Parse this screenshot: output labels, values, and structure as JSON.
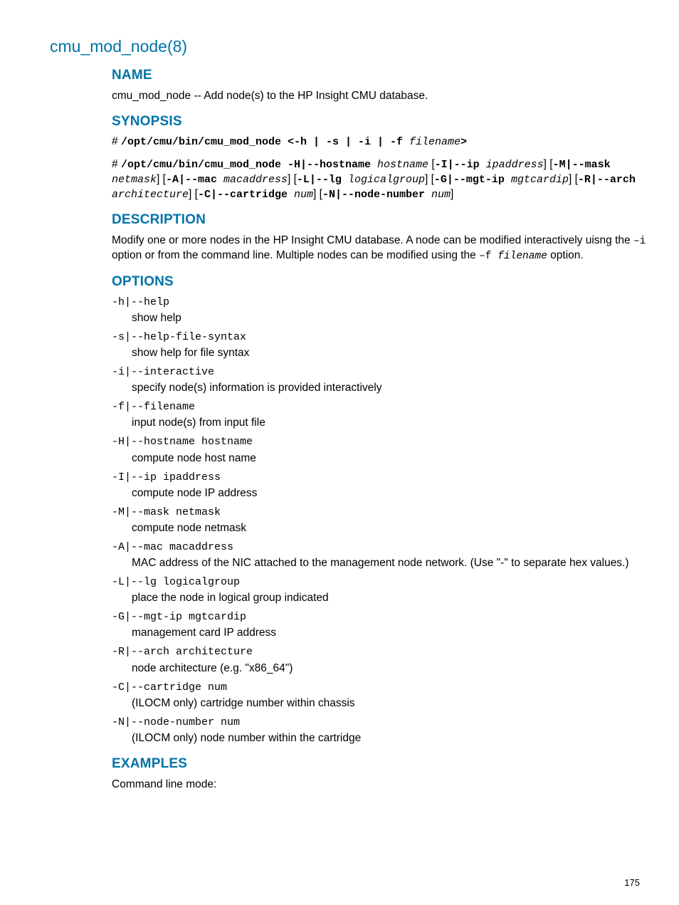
{
  "pageTitle": "cmu_mod_node(8)",
  "sections": {
    "name": {
      "heading": "NAME",
      "text_a": "cmu_mod_node -- Add node(s) to the HP Insight CMU database."
    },
    "synopsis": {
      "heading": "SYNOPSIS",
      "line1": {
        "prefix": "# ",
        "cmd": "/opt/cmu/bin/cmu_mod_node",
        "opts": " <-h | -s | -i | -f ",
        "arg": "filename",
        "end": ">"
      },
      "line2": {
        "prefix": "# ",
        "cmd": "/opt/cmu/bin/cmu_mod_node -H|--hostname ",
        "arg_host": "hostname",
        "seg_ip_a": " [",
        "seg_ip_b": "-I|--ip ",
        "arg_ip": "ipaddress",
        "seg_ip_c": "]",
        "seg_mask_a": " [",
        "seg_mask_b": "-M|--mask ",
        "arg_mask": "netmask",
        "seg_mask_c": "]",
        "seg_mac_a": " [",
        "seg_mac_b": "-A|--mac ",
        "arg_mac": "macaddress",
        "seg_mac_c": "]",
        "seg_lg_a": " [",
        "seg_lg_b": "-L|--lg ",
        "arg_lg": "logicalgroup",
        "seg_lg_c": "]",
        "seg_mgt_a": " [",
        "seg_mgt_b": "-G|--mgt-ip ",
        "arg_mgt": "mgtcardip",
        "seg_mgt_c": "]",
        "seg_arch_a": " [",
        "seg_arch_b": "-R|--arch ",
        "arg_arch": "architecture",
        "seg_arch_c": "]",
        "seg_cart_a": " [",
        "seg_cart_b": "-C|--cartridge ",
        "arg_cart": "num",
        "seg_cart_c": "]",
        "seg_node_a": " [",
        "seg_node_b": "-N|--node-number ",
        "arg_node": "num",
        "seg_node_c": "]"
      }
    },
    "description": {
      "heading": "DESCRIPTION",
      "text_a": "Modify one or more nodes in the HP Insight CMU database. A node can be modified interactively uisng the ",
      "code_a": "–i",
      "text_b": " option or from the command line. Multiple nodes can be modified using the ",
      "code_b": "–f ",
      "code_b_arg": "filename",
      "text_c": " option."
    },
    "options": {
      "heading": "OPTIONS",
      "items": [
        {
          "flag": "-h|--help",
          "desc": "show help"
        },
        {
          "flag": "-s|--help-file-syntax",
          "desc": "show help for file syntax"
        },
        {
          "flag": "-i|--interactive",
          "desc": "specify node(s) information is provided interactively"
        },
        {
          "flag": "-f|--filename",
          "desc": "input node(s) from input file"
        },
        {
          "flag": "-H|--hostname hostname",
          "desc": "compute node host name"
        },
        {
          "flag": "-I|--ip ipaddress",
          "desc": "compute node IP address"
        },
        {
          "flag": "-M|--mask netmask",
          "desc": "compute node netmask"
        },
        {
          "flag": "-A|--mac macaddress",
          "desc": "MAC address of the NIC attached to the management node network. (Use \"-\" to separate hex values.)"
        },
        {
          "flag": "-L|--lg logicalgroup",
          "desc": "place the node in logical group indicated"
        },
        {
          "flag": "-G|--mgt-ip mgtcardip",
          "desc": "management card IP address"
        },
        {
          "flag": "-R|--arch architecture",
          "desc": "node architecture (e.g. \"x86_64\")"
        },
        {
          "flag": "-C|--cartridge num",
          "desc": "(ILOCM only) cartridge number within chassis"
        },
        {
          "flag": "-N|--node-number num",
          "desc": "(ILOCM only) node number within the cartridge"
        }
      ]
    },
    "examples": {
      "heading": "EXAMPLES",
      "text_a": "Command line mode:"
    }
  },
  "pageNumber": "175"
}
